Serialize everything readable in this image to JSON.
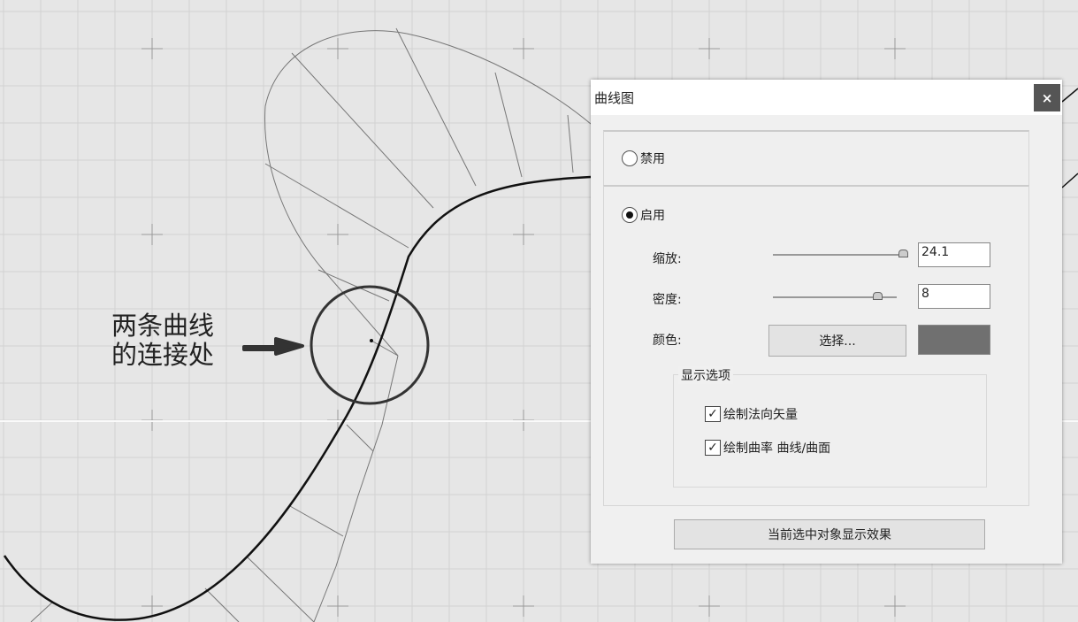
{
  "annotation": {
    "line1": "两条曲线",
    "line2": "的连接处"
  },
  "dialog": {
    "title": "曲线图",
    "close_label": "×",
    "disable_label": "禁用",
    "enable_label": "启用",
    "enabled": true,
    "scale": {
      "label": "缩放:",
      "value": "24.1",
      "slider_fraction": 0.97
    },
    "density": {
      "label": "密度:",
      "value": "8",
      "slider_fraction": 0.8
    },
    "color": {
      "label": "颜色:",
      "button_label": "选择...",
      "swatch": "#707070"
    },
    "display_options": {
      "title": "显示选项",
      "draw_normals": {
        "label": "绘制法向矢量",
        "checked": true
      },
      "draw_curvature": {
        "label": "绘制曲率 曲线/曲面",
        "checked": true
      }
    },
    "apply_label": "当前选中对象显示效果"
  }
}
